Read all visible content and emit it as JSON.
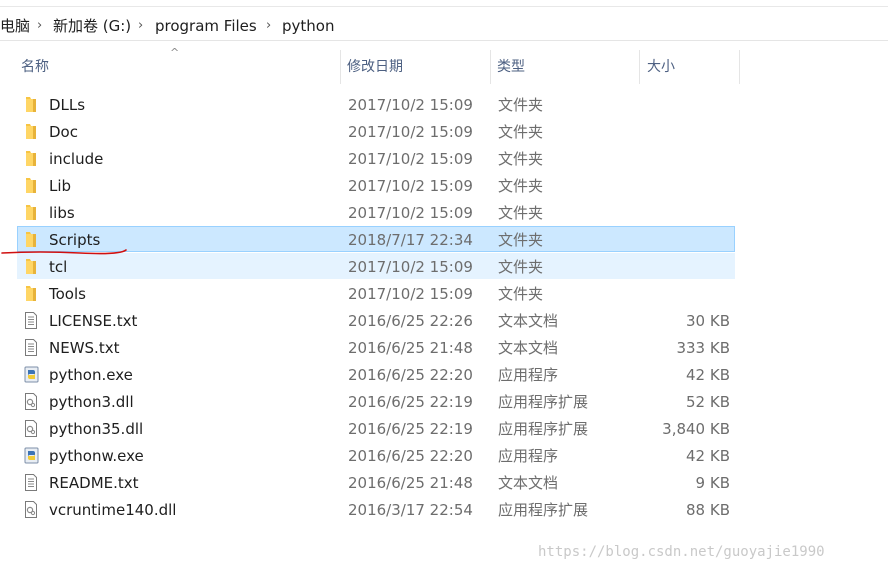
{
  "breadcrumb": [
    "电脑",
    "新加卷 (G:)",
    "program Files",
    "python"
  ],
  "columns": {
    "name": "名称",
    "date": "修改日期",
    "type": "类型",
    "size": "大小"
  },
  "files": [
    {
      "name": "DLLs",
      "date": "2017/10/2 15:09",
      "type": "文件夹",
      "size": "",
      "icon": "folder-icon",
      "state": ""
    },
    {
      "name": "Doc",
      "date": "2017/10/2 15:09",
      "type": "文件夹",
      "size": "",
      "icon": "folder-icon",
      "state": ""
    },
    {
      "name": "include",
      "date": "2017/10/2 15:09",
      "type": "文件夹",
      "size": "",
      "icon": "folder-icon",
      "state": ""
    },
    {
      "name": "Lib",
      "date": "2017/10/2 15:09",
      "type": "文件夹",
      "size": "",
      "icon": "folder-icon",
      "state": ""
    },
    {
      "name": "libs",
      "date": "2017/10/2 15:09",
      "type": "文件夹",
      "size": "",
      "icon": "folder-icon",
      "state": ""
    },
    {
      "name": "Scripts",
      "date": "2018/7/17 22:34",
      "type": "文件夹",
      "size": "",
      "icon": "folder-icon",
      "state": "selected"
    },
    {
      "name": "tcl",
      "date": "2017/10/2 15:09",
      "type": "文件夹",
      "size": "",
      "icon": "folder-icon",
      "state": "hover"
    },
    {
      "name": "Tools",
      "date": "2017/10/2 15:09",
      "type": "文件夹",
      "size": "",
      "icon": "folder-icon",
      "state": ""
    },
    {
      "name": "LICENSE.txt",
      "date": "2016/6/25 22:26",
      "type": "文本文档",
      "size": "30 KB",
      "icon": "text-file-icon",
      "state": ""
    },
    {
      "name": "NEWS.txt",
      "date": "2016/6/25 21:48",
      "type": "文本文档",
      "size": "333 KB",
      "icon": "text-file-icon",
      "state": ""
    },
    {
      "name": "python.exe",
      "date": "2016/6/25 22:20",
      "type": "应用程序",
      "size": "42 KB",
      "icon": "python-exe-icon",
      "state": ""
    },
    {
      "name": "python3.dll",
      "date": "2016/6/25 22:19",
      "type": "应用程序扩展",
      "size": "52 KB",
      "icon": "dll-file-icon",
      "state": ""
    },
    {
      "name": "python35.dll",
      "date": "2016/6/25 22:19",
      "type": "应用程序扩展",
      "size": "3,840 KB",
      "icon": "dll-file-icon",
      "state": ""
    },
    {
      "name": "pythonw.exe",
      "date": "2016/6/25 22:20",
      "type": "应用程序",
      "size": "42 KB",
      "icon": "python-exe-icon",
      "state": ""
    },
    {
      "name": "README.txt",
      "date": "2016/6/25 21:48",
      "type": "文本文档",
      "size": "9 KB",
      "icon": "text-file-icon",
      "state": ""
    },
    {
      "name": "vcruntime140.dll",
      "date": "2016/3/17 22:54",
      "type": "应用程序扩展",
      "size": "88 KB",
      "icon": "dll-file-icon",
      "state": ""
    }
  ],
  "watermark": "https://blog.csdn.net/guoyajie1990",
  "colors": {
    "selected_bg": "#cce8ff",
    "hover_bg": "#e5f3ff",
    "header_text": "#4d6082",
    "annotation": "#d01010"
  }
}
